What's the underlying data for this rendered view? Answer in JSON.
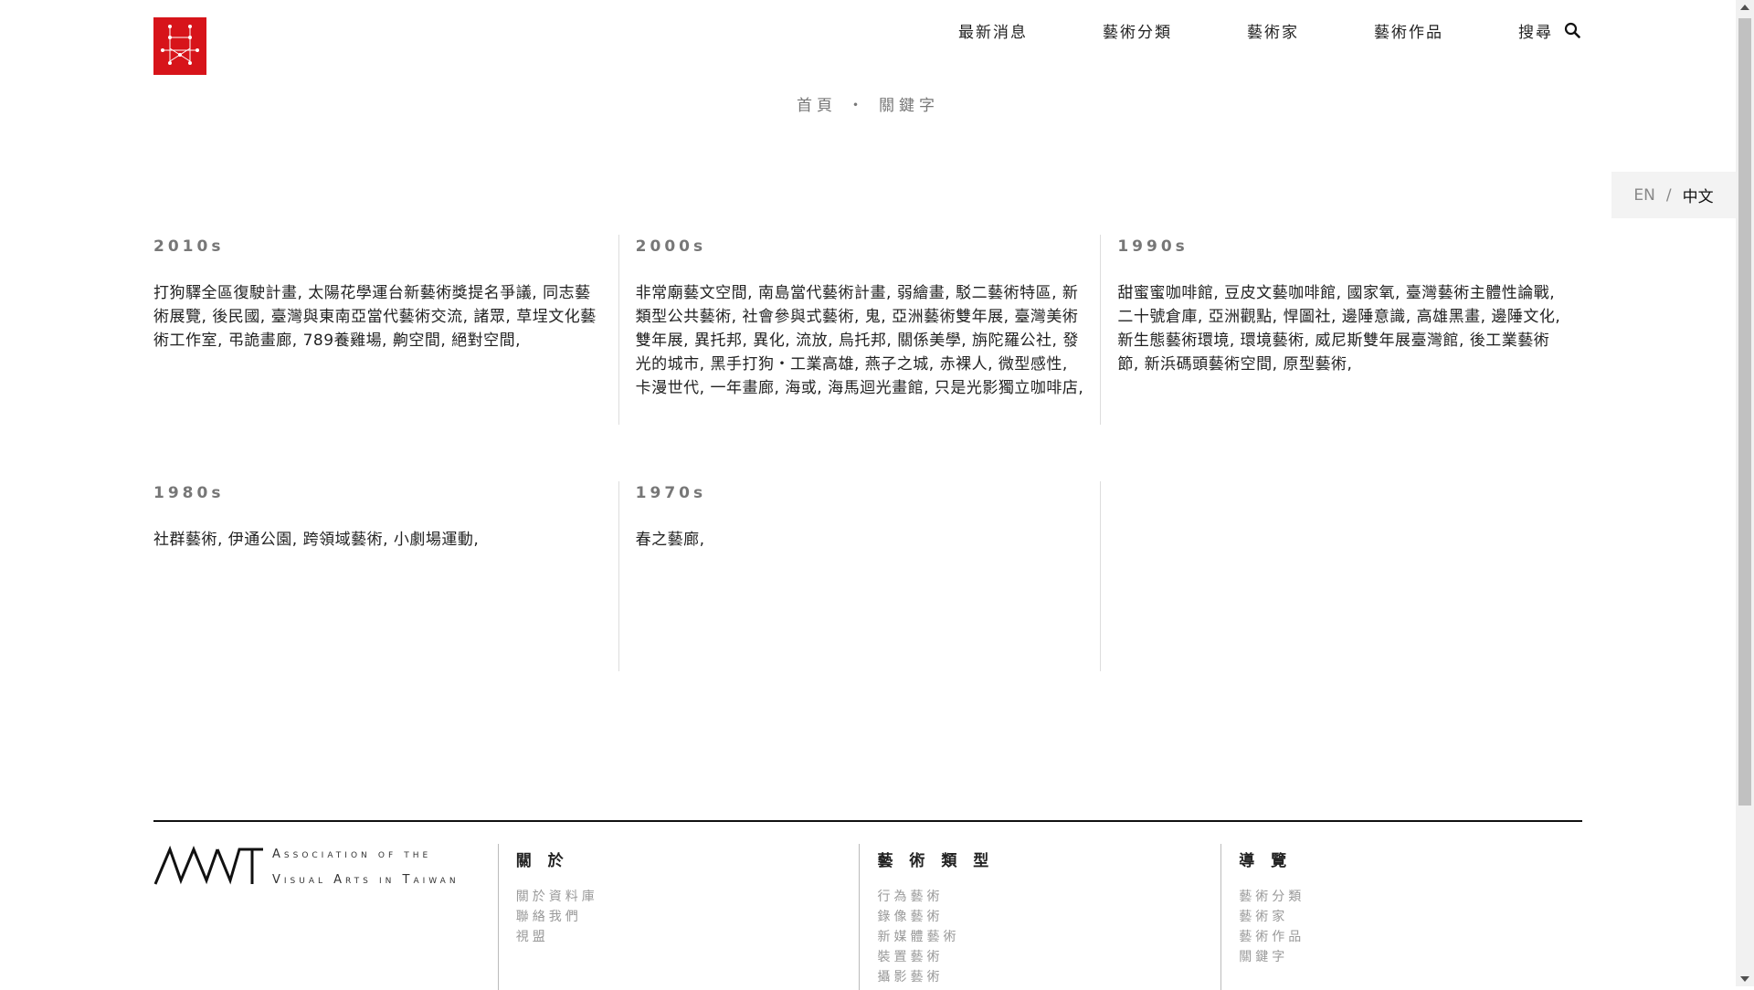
{
  "nav": {
    "items": [
      "最新消息",
      "藝術分類",
      "藝術家",
      "藝術作品"
    ],
    "search_label": "搜尋"
  },
  "breadcrumb": {
    "home": "首頁",
    "separator": "・",
    "current": "關鍵字"
  },
  "lang": {
    "en": "EN",
    "slash": "/",
    "zh": "中文"
  },
  "decades": [
    {
      "label": "2010s",
      "keywords": "打狗驛全區復駛計畫, 太陽花學運台新藝術獎提名爭議, 同志藝術展覽, 後民國, 臺灣與東南亞當代藝術交流, 諸眾, 草埕文化藝術工作室, 弔詭畫廊, 789養雞場, 齁空間, 絕對空間,"
    },
    {
      "label": "2000s",
      "keywords": "非常廟藝文空間, 南島當代藝術計畫, 弱繪畫, 駁二藝術特區, 新類型公共藝術, 社會參與式藝術, 鬼, 亞洲藝術雙年展, 臺灣美術雙年展, 異托邦, 異化, 流放, 烏托邦, 關係美學, 旃陀羅公社, 發光的城市, 黑手打狗・工業高雄, 燕子之城, 赤裸人, 微型感性, 卡漫世代, 一年畫廊, 海或, 海馬迴光畫館, 只是光影獨立咖啡店,"
    },
    {
      "label": "1990s",
      "keywords": "甜蜜蜜咖啡館, 豆皮文藝咖啡館, 國家氧, 臺灣藝術主體性論戰, 二十號倉庫, 亞洲觀點, 悍圖社, 邊陲意識, 高雄黑畫, 邊陲文化, 新生態藝術環境, 環境藝術, 威尼斯雙年展臺灣館, 後工業藝術節, 新浜碼頭藝術空間, 原型藝術,"
    },
    {
      "label": "1980s",
      "keywords": "社群藝術, 伊通公園, 跨領域藝術, 小劇場運動,"
    },
    {
      "label": "1970s",
      "keywords": "春之藝廊,"
    }
  ],
  "footer": {
    "association_line1": "Association of the",
    "association_line2": "Visual Arts in Taiwan",
    "about": {
      "title": "關 於",
      "links": [
        "關於資料庫",
        "聯絡我們",
        "視盟"
      ]
    },
    "art_types": {
      "title": "藝 術 類 型",
      "links": [
        "行為藝術",
        "錄像藝術",
        "新媒體藝術",
        "裝置藝術",
        "攝影藝術"
      ]
    },
    "guide": {
      "title": "導 覽",
      "links": [
        "藝術分類",
        "藝術家",
        "藝術作品",
        "關鍵字"
      ]
    }
  },
  "colors": {
    "brand_red": "#d7141a",
    "text": "#222222",
    "muted": "#777777"
  }
}
